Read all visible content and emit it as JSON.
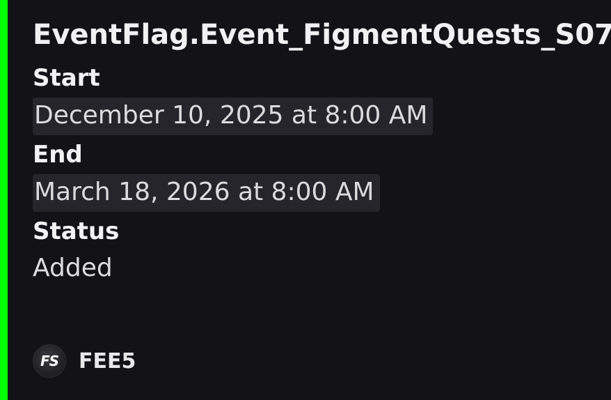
{
  "embed": {
    "accent_color": "#00ff00",
    "title": "EventFlag.Event_FigmentQuests_S07",
    "fields": [
      {
        "name": "Start",
        "value": "December 10, 2025 at 8:00 AM"
      },
      {
        "name": "End",
        "value": "March 18, 2026 at 8:00 AM"
      },
      {
        "name": "Status",
        "value": "Added"
      }
    ],
    "footer": {
      "avatar_text": "FS",
      "author": "FEE5"
    }
  }
}
